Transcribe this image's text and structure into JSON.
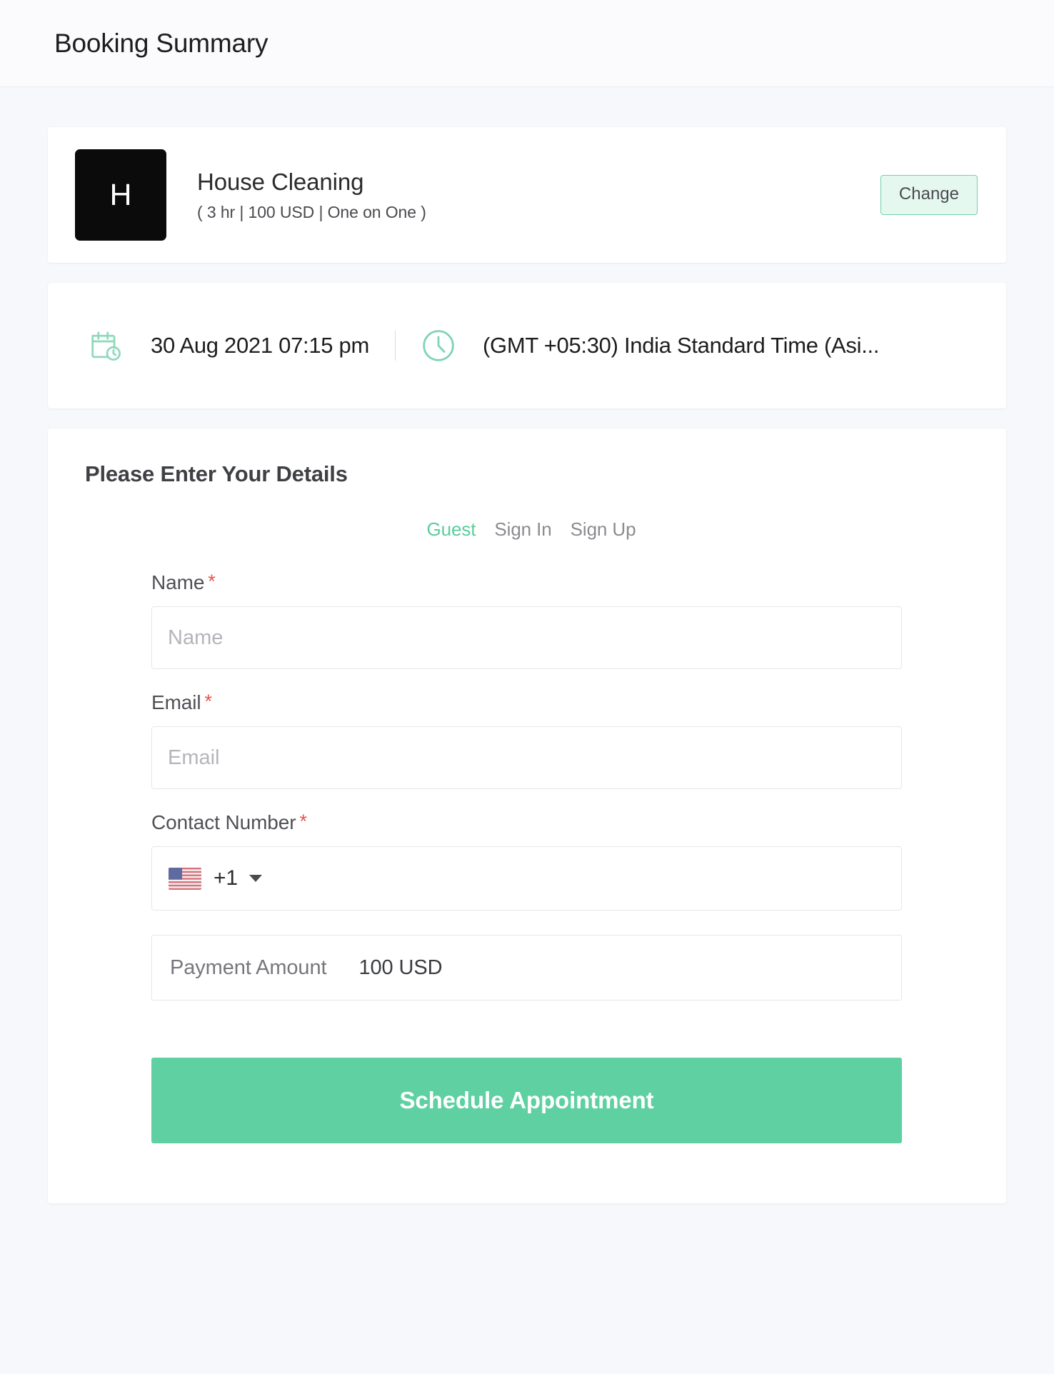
{
  "header": {
    "title": "Booking Summary"
  },
  "service": {
    "avatar_letter": "H",
    "name": "House Cleaning",
    "meta": "( 3 hr | 100 USD | One on One )",
    "change_label": "Change"
  },
  "when": {
    "calendar_icon": "calendar-clock-icon",
    "datetime": "30 Aug 2021 07:15 pm",
    "clock_icon": "clock-icon",
    "timezone": "(GMT +05:30) India Standard Time (Asi..."
  },
  "details": {
    "title": "Please Enter Your Details",
    "tabs": [
      {
        "label": "Guest",
        "active": true
      },
      {
        "label": "Sign In",
        "active": false
      },
      {
        "label": "Sign Up",
        "active": false
      }
    ],
    "fields": {
      "name": {
        "label": "Name",
        "required_marker": "*",
        "placeholder": "Name",
        "value": ""
      },
      "email": {
        "label": "Email",
        "required_marker": "*",
        "placeholder": "Email",
        "value": ""
      },
      "contact": {
        "label": "Contact Number",
        "required_marker": "*",
        "flag": "us-flag-icon",
        "dial_code": "+1",
        "placeholder": "",
        "value": ""
      }
    },
    "payment": {
      "label": "Payment Amount",
      "value": "100 USD"
    },
    "submit_label": "Schedule Appointment"
  },
  "colors": {
    "accent_green": "#5ed0a1",
    "accent_green_light": "#e5f8ef",
    "accent_green_border": "#72d3a6",
    "required_red": "#e8544b",
    "page_background": "#f7f8fc",
    "avatar_background": "#0b0b0b"
  }
}
